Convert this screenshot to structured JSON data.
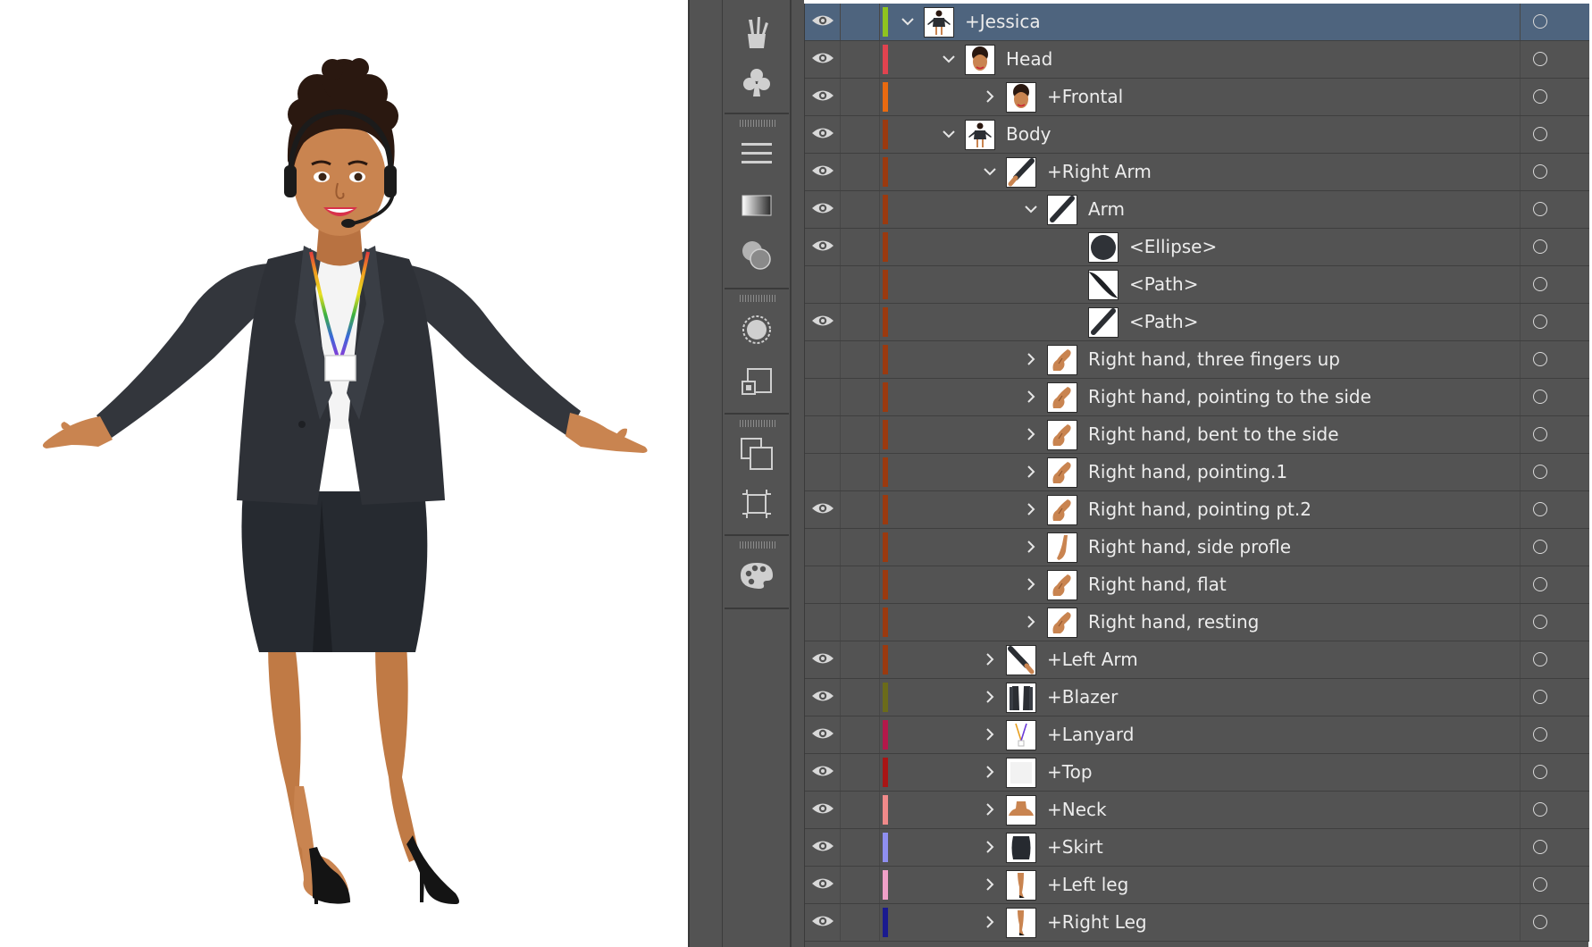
{
  "layers_panel": {
    "rows": [
      {
        "name": "+Jessica",
        "depth": 0,
        "expanded": true,
        "visible": true,
        "color": "#8fc41f",
        "thumb": "figure",
        "selected": true
      },
      {
        "name": "Head",
        "depth": 1,
        "expanded": true,
        "visible": true,
        "color": "#e0434f",
        "thumb": "face"
      },
      {
        "name": "+Frontal",
        "depth": 2,
        "expanded": false,
        "visible": true,
        "color": "#e86a10",
        "thumb": "face"
      },
      {
        "name": "Body",
        "depth": 1,
        "expanded": true,
        "visible": true,
        "color": "#9b3a0f",
        "thumb": "figure"
      },
      {
        "name": "+Right Arm",
        "depth": 2,
        "expanded": true,
        "visible": true,
        "color": "#9b3a0f",
        "thumb": "arm-skin"
      },
      {
        "name": "Arm",
        "depth": 3,
        "expanded": true,
        "visible": true,
        "color": "#9b3a0f",
        "thumb": "arm"
      },
      {
        "name": "<Ellipse>",
        "depth": 4,
        "expanded": null,
        "visible": true,
        "color": "#9b3a0f",
        "thumb": "ellipse"
      },
      {
        "name": "<Path>",
        "depth": 4,
        "expanded": null,
        "visible": false,
        "color": "#9b3a0f",
        "thumb": "path-thick"
      },
      {
        "name": "<Path>",
        "depth": 4,
        "expanded": null,
        "visible": true,
        "color": "#9b3a0f",
        "thumb": "arm"
      },
      {
        "name": "Right hand, three fingers up",
        "depth": 3,
        "expanded": false,
        "visible": false,
        "color": "#9b3a0f",
        "thumb": "hand"
      },
      {
        "name": "Right hand, pointing to the side",
        "depth": 3,
        "expanded": false,
        "visible": false,
        "color": "#9b3a0f",
        "thumb": "hand"
      },
      {
        "name": "Right hand, bent to the side",
        "depth": 3,
        "expanded": false,
        "visible": false,
        "color": "#9b3a0f",
        "thumb": "hand"
      },
      {
        "name": "Right hand, pointing.1",
        "depth": 3,
        "expanded": false,
        "visible": false,
        "color": "#9b3a0f",
        "thumb": "hand"
      },
      {
        "name": "Right hand, pointing pt.2",
        "depth": 3,
        "expanded": false,
        "visible": true,
        "color": "#9b3a0f",
        "thumb": "hand"
      },
      {
        "name": "Right hand, side profle",
        "depth": 3,
        "expanded": false,
        "visible": false,
        "color": "#9b3a0f",
        "thumb": "hand-side"
      },
      {
        "name": "Right hand, flat",
        "depth": 3,
        "expanded": false,
        "visible": false,
        "color": "#9b3a0f",
        "thumb": "hand"
      },
      {
        "name": "Right hand, resting",
        "depth": 3,
        "expanded": false,
        "visible": false,
        "color": "#9b3a0f",
        "thumb": "hand"
      },
      {
        "name": "+Left Arm",
        "depth": 2,
        "expanded": false,
        "visible": true,
        "color": "#9b3a0f",
        "thumb": "arm-skin-left"
      },
      {
        "name": "+Blazer",
        "depth": 2,
        "expanded": false,
        "visible": true,
        "color": "#6b6b1a",
        "thumb": "blazer"
      },
      {
        "name": "+Lanyard",
        "depth": 2,
        "expanded": false,
        "visible": true,
        "color": "#b3184a",
        "thumb": "lanyard"
      },
      {
        "name": "+Top",
        "depth": 2,
        "expanded": false,
        "visible": true,
        "color": "#a81515",
        "thumb": "top"
      },
      {
        "name": "+Neck",
        "depth": 2,
        "expanded": false,
        "visible": true,
        "color": "#f08a8a",
        "thumb": "neck"
      },
      {
        "name": "+Skirt",
        "depth": 2,
        "expanded": false,
        "visible": true,
        "color": "#8f8ff0",
        "thumb": "skirt"
      },
      {
        "name": "+Left leg",
        "depth": 2,
        "expanded": false,
        "visible": true,
        "color": "#f0a0c8",
        "thumb": "leg"
      },
      {
        "name": "+Right Leg",
        "depth": 2,
        "expanded": false,
        "visible": true,
        "color": "#1a1a8f",
        "thumb": "leg"
      }
    ]
  },
  "tools": [
    {
      "name": "brushes-icon"
    },
    {
      "name": "symbols-icon"
    },
    {
      "name": "stroke-icon"
    },
    {
      "name": "gradient-icon"
    },
    {
      "name": "transparency-icon"
    },
    {
      "name": "appearance-icon"
    },
    {
      "name": "graphic-styles-icon"
    },
    {
      "name": "layers-icon"
    },
    {
      "name": "artboards-icon"
    },
    {
      "name": "color-guide-icon"
    }
  ],
  "colors": {
    "panel_bg": "#535353",
    "row_selected": "#4e647e",
    "text": "#ececec",
    "skin": "#c98450",
    "suit": "#2b2e33",
    "hair": "#2a1810"
  }
}
